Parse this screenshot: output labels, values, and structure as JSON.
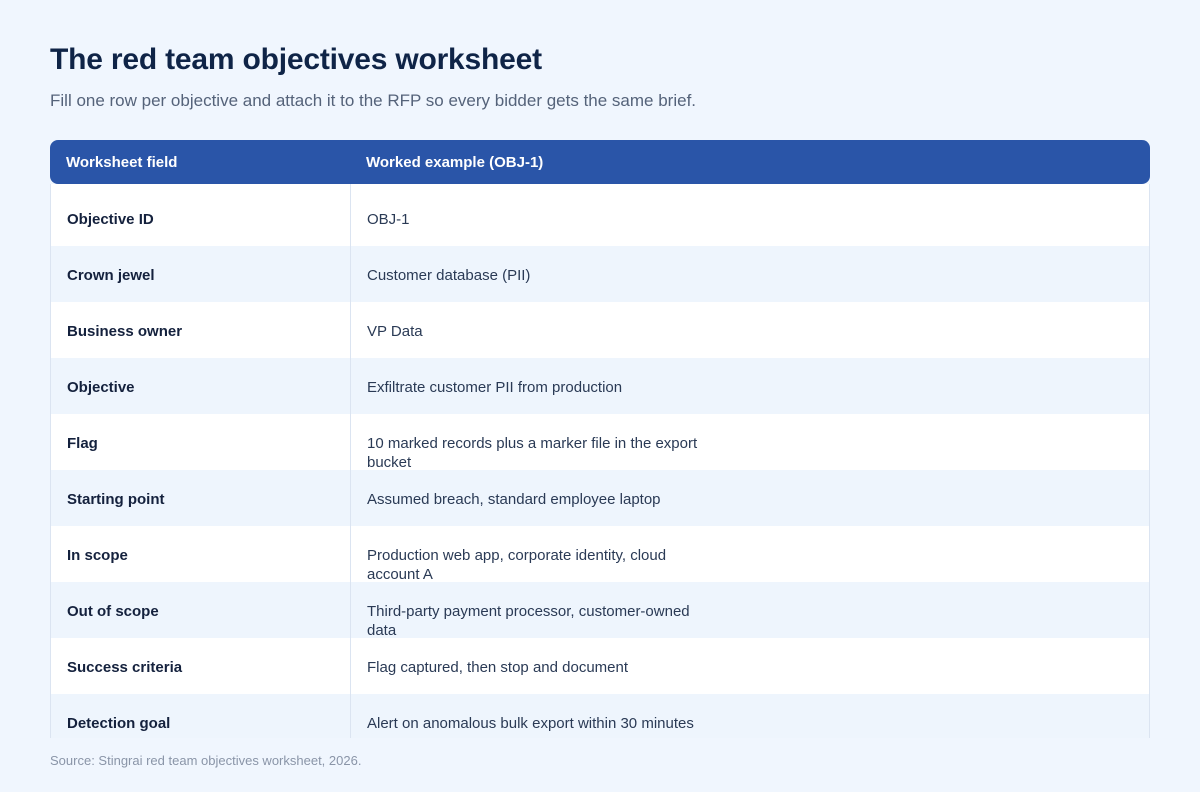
{
  "title": "The red team objectives worksheet",
  "subtitle": "Fill one row per objective and attach it to the RFP so every bidder gets the same brief.",
  "table": {
    "headers": [
      "Worksheet field",
      "Worked example (OBJ-1)"
    ],
    "rows": [
      {
        "field": "Objective ID",
        "value": "OBJ-1"
      },
      {
        "field": "Crown jewel",
        "value": "Customer database (PII)"
      },
      {
        "field": "Business owner",
        "value": "VP Data"
      },
      {
        "field": "Objective",
        "value": "Exfiltrate customer PII from production"
      },
      {
        "field": "Flag",
        "value": "10 marked records plus a marker file in the export bucket"
      },
      {
        "field": "Starting point",
        "value": "Assumed breach, standard employee laptop"
      },
      {
        "field": "In scope",
        "value": "Production web app, corporate identity, cloud account A"
      },
      {
        "field": "Out of scope",
        "value": "Third-party payment processor, customer-owned data"
      },
      {
        "field": "Success criteria",
        "value": "Flag captured, then stop and document"
      },
      {
        "field": "Detection goal",
        "value": "Alert on anomalous bulk export within 30 minutes"
      }
    ]
  },
  "source": "Source: Stingrai red team objectives worksheet, 2026.",
  "colors": {
    "background": "#f0f6fe",
    "header": "#2a55a8",
    "row_alt": "#eef5fd",
    "title": "#0f2447"
  }
}
